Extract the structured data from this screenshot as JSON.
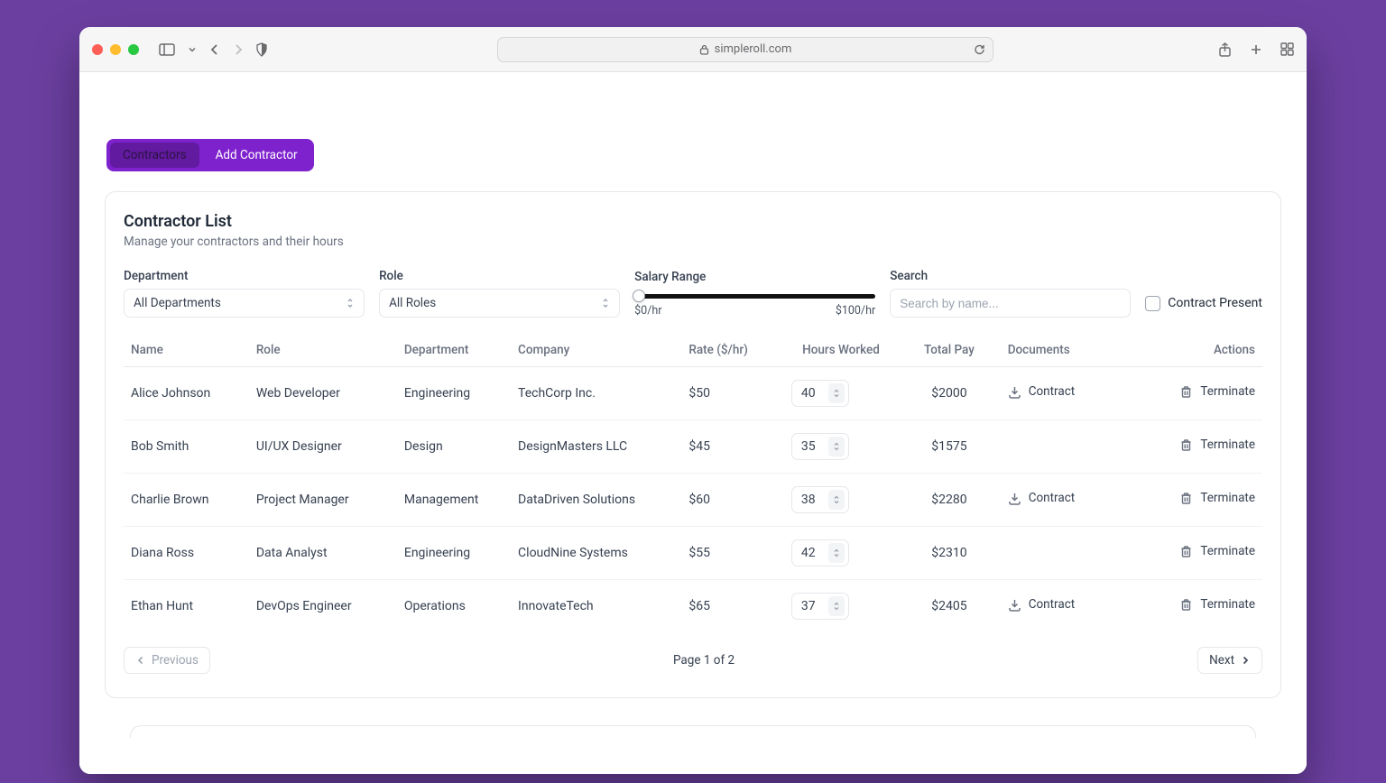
{
  "browser": {
    "url_host": "simpleroll.com"
  },
  "tabs": {
    "contractors": "Contractors",
    "add_contractor": "Add Contractor"
  },
  "card": {
    "title": "Contractor List",
    "subtitle": "Manage your contractors and their hours"
  },
  "filters": {
    "department": {
      "label": "Department",
      "value": "All Departments"
    },
    "role": {
      "label": "Role",
      "value": "All Roles"
    },
    "salary": {
      "label": "Salary Range",
      "min": "$0/hr",
      "max": "$100/hr"
    },
    "search": {
      "label": "Search",
      "placeholder": "Search by name..."
    },
    "contract_present": {
      "label": "Contract Present"
    }
  },
  "columns": {
    "name": "Name",
    "role": "Role",
    "department": "Department",
    "company": "Company",
    "rate": "Rate ($/hr)",
    "hours": "Hours Worked",
    "total": "Total Pay",
    "documents": "Documents",
    "actions": "Actions"
  },
  "doc_label": "Contract",
  "terminate_label": "Terminate",
  "rows": [
    {
      "name": "Alice Johnson",
      "role": "Web Developer",
      "department": "Engineering",
      "company": "TechCorp Inc.",
      "rate": "$50",
      "hours": "40",
      "total": "$2000",
      "has_doc": true
    },
    {
      "name": "Bob Smith",
      "role": "UI/UX Designer",
      "department": "Design",
      "company": "DesignMasters LLC",
      "rate": "$45",
      "hours": "35",
      "total": "$1575",
      "has_doc": false
    },
    {
      "name": "Charlie Brown",
      "role": "Project Manager",
      "department": "Management",
      "company": "DataDriven Solutions",
      "rate": "$60",
      "hours": "38",
      "total": "$2280",
      "has_doc": true
    },
    {
      "name": "Diana Ross",
      "role": "Data Analyst",
      "department": "Engineering",
      "company": "CloudNine Systems",
      "rate": "$55",
      "hours": "42",
      "total": "$2310",
      "has_doc": false
    },
    {
      "name": "Ethan Hunt",
      "role": "DevOps Engineer",
      "department": "Operations",
      "company": "InnovateTech",
      "rate": "$65",
      "hours": "37",
      "total": "$2405",
      "has_doc": true
    }
  ],
  "pagination": {
    "prev": "Previous",
    "next": "Next",
    "status": "Page 1 of 2"
  }
}
